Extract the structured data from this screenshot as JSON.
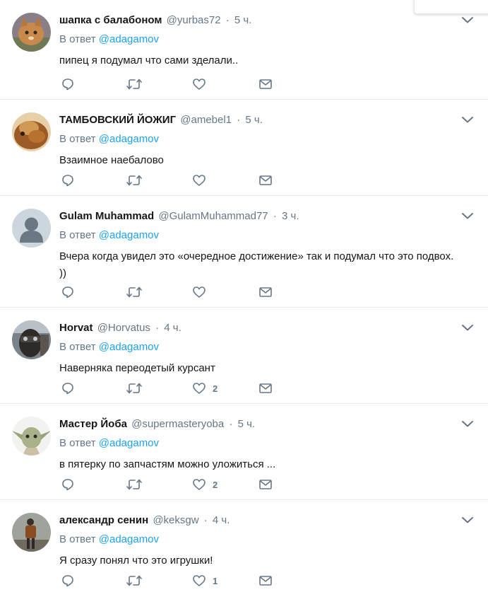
{
  "tweets": [
    {
      "name": "шапка с балабоном",
      "handle": "@yurbas72",
      "time": "5 ч.",
      "reply_prefix": "В ответ",
      "reply_to": "@adagamov",
      "text": "пипец я подумал что сами зделали..",
      "likes": "",
      "avatar_icon": "cat-photo-avatar"
    },
    {
      "name": "ТАМБОВСКИЙ ЙОЖИГ",
      "handle": "@amebel1",
      "time": "5 ч.",
      "reply_prefix": "В ответ",
      "reply_to": "@adagamov",
      "text": "Взаимное наебалово",
      "likes": "",
      "avatar_icon": "hedgehog-photo-avatar"
    },
    {
      "name": "Gulam Muhammad",
      "handle": "@GulamMuhammad77",
      "time": "3 ч.",
      "reply_prefix": "В ответ",
      "reply_to": "@adagamov",
      "text": "Вчера когда увидел это «очередное достижение» так и подумал что это подвох. ))",
      "likes": "",
      "avatar_icon": "default-profile-avatar"
    },
    {
      "name": "Horvat",
      "handle": "@Horvatus",
      "time": "4 ч.",
      "reply_prefix": "В ответ",
      "reply_to": "@adagamov",
      "text": "Наверняка переодетый курсант",
      "likes": "2",
      "avatar_icon": "masked-figure-avatar"
    },
    {
      "name": "Мастер Йоба",
      "handle": "@supermasteryoba",
      "time": "5 ч.",
      "reply_prefix": "В ответ",
      "reply_to": "@adagamov",
      "text": "в пятерку по запчастям можно уложиться ...",
      "likes": "2",
      "avatar_icon": "yoda-avatar"
    },
    {
      "name": "александр сенин",
      "handle": "@keksgw",
      "time": "4 ч.",
      "reply_prefix": "В ответ",
      "reply_to": "@adagamov",
      "text": "Я сразу понял что это игрушки!",
      "likes": "1",
      "avatar_icon": "person-standing-avatar"
    }
  ],
  "colors": {
    "link": "#1da1f2",
    "secondary": "#657786",
    "text": "#14171a",
    "border": "#e6ecf0"
  }
}
